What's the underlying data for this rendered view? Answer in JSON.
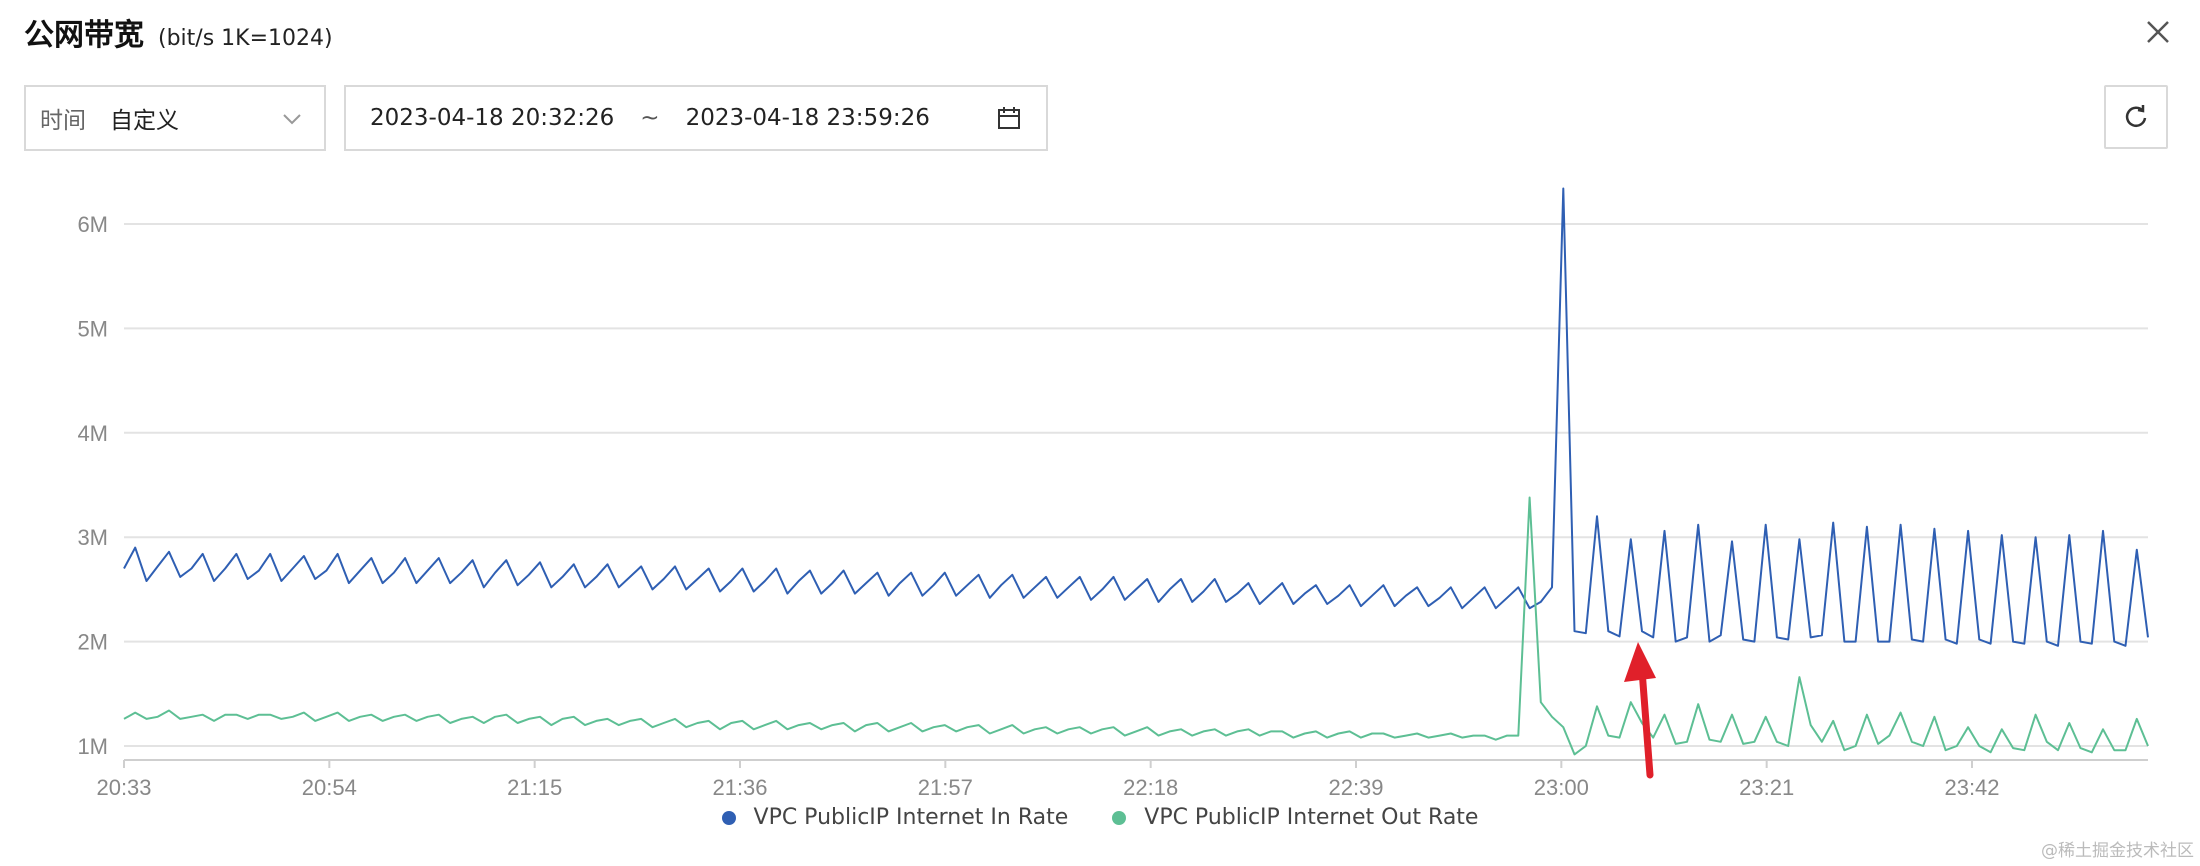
{
  "header": {
    "title": "公网带宽",
    "subtitle": "(bit/s  1K=1024)"
  },
  "time_filter": {
    "label": "时间",
    "value": "自定义"
  },
  "date_range": {
    "start": "2023-04-18 20:32:26",
    "separator": "~",
    "end": "2023-04-18 23:59:26"
  },
  "icons": {
    "close": "close-icon",
    "chevron": "chevron-down-icon",
    "calendar": "calendar-icon",
    "refresh": "refresh-icon"
  },
  "watermark": "@稀土掘金技术社区",
  "chart_data": {
    "type": "line",
    "x_start_minutes": 0,
    "x_end_minutes": 207,
    "x_ticks": [
      "20:33",
      "20:54",
      "21:15",
      "21:36",
      "21:57",
      "22:18",
      "22:39",
      "23:00",
      "23:21",
      "23:42"
    ],
    "y_ticks": [
      "1M",
      "2M",
      "3M",
      "4M",
      "5M",
      "6M"
    ],
    "ylim": [
      1,
      6
    ],
    "grid": true,
    "legend_position": "bottom",
    "series": [
      {
        "name": "VPC PublicIP Internet In Rate",
        "color": "#2f5fb3",
        "values": [
          2.7,
          2.9,
          2.58,
          2.72,
          2.86,
          2.62,
          2.7,
          2.84,
          2.58,
          2.7,
          2.84,
          2.6,
          2.68,
          2.84,
          2.58,
          2.7,
          2.82,
          2.6,
          2.68,
          2.84,
          2.56,
          2.68,
          2.8,
          2.56,
          2.66,
          2.8,
          2.56,
          2.68,
          2.8,
          2.56,
          2.66,
          2.78,
          2.52,
          2.66,
          2.78,
          2.54,
          2.64,
          2.76,
          2.52,
          2.62,
          2.74,
          2.52,
          2.62,
          2.74,
          2.52,
          2.62,
          2.72,
          2.5,
          2.6,
          2.72,
          2.5,
          2.6,
          2.7,
          2.48,
          2.58,
          2.7,
          2.48,
          2.58,
          2.7,
          2.46,
          2.58,
          2.68,
          2.46,
          2.56,
          2.68,
          2.46,
          2.56,
          2.66,
          2.44,
          2.56,
          2.66,
          2.44,
          2.54,
          2.66,
          2.44,
          2.54,
          2.64,
          2.42,
          2.54,
          2.64,
          2.42,
          2.52,
          2.62,
          2.42,
          2.52,
          2.62,
          2.4,
          2.5,
          2.62,
          2.4,
          2.5,
          2.6,
          2.38,
          2.5,
          2.6,
          2.38,
          2.48,
          2.6,
          2.38,
          2.46,
          2.56,
          2.36,
          2.46,
          2.56,
          2.36,
          2.46,
          2.54,
          2.36,
          2.44,
          2.54,
          2.34,
          2.44,
          2.54,
          2.34,
          2.44,
          2.52,
          2.34,
          2.42,
          2.52,
          2.32,
          2.42,
          2.52,
          2.32,
          2.42,
          2.52,
          2.32,
          2.38,
          2.52,
          6.34,
          2.1,
          2.08,
          3.2,
          2.1,
          2.05,
          2.98,
          2.1,
          2.04,
          3.06,
          2.0,
          2.04,
          3.12,
          2.0,
          2.06,
          2.96,
          2.02,
          2.0,
          3.12,
          2.04,
          2.02,
          2.98,
          2.04,
          2.06,
          3.14,
          2.0,
          2.0,
          3.1,
          2.0,
          2.0,
          3.12,
          2.02,
          2.0,
          3.08,
          2.02,
          1.98,
          3.06,
          2.02,
          1.98,
          3.02,
          2.0,
          1.98,
          3.0,
          2.0,
          1.96,
          3.02,
          2.0,
          1.98,
          3.06,
          2.0,
          1.96,
          2.88,
          2.04
        ]
      },
      {
        "name": "VPC PublicIP Internet Out Rate",
        "color": "#5dbf94",
        "values": [
          1.26,
          1.32,
          1.26,
          1.28,
          1.34,
          1.26,
          1.28,
          1.3,
          1.24,
          1.3,
          1.3,
          1.26,
          1.3,
          1.3,
          1.26,
          1.28,
          1.32,
          1.24,
          1.28,
          1.32,
          1.24,
          1.28,
          1.3,
          1.24,
          1.28,
          1.3,
          1.24,
          1.28,
          1.3,
          1.22,
          1.26,
          1.28,
          1.22,
          1.28,
          1.3,
          1.22,
          1.26,
          1.28,
          1.2,
          1.26,
          1.28,
          1.2,
          1.24,
          1.26,
          1.2,
          1.24,
          1.26,
          1.18,
          1.22,
          1.26,
          1.18,
          1.22,
          1.24,
          1.16,
          1.22,
          1.24,
          1.16,
          1.2,
          1.24,
          1.16,
          1.2,
          1.22,
          1.16,
          1.2,
          1.22,
          1.14,
          1.2,
          1.22,
          1.14,
          1.18,
          1.22,
          1.14,
          1.18,
          1.2,
          1.14,
          1.18,
          1.2,
          1.12,
          1.16,
          1.2,
          1.12,
          1.16,
          1.18,
          1.12,
          1.16,
          1.18,
          1.12,
          1.16,
          1.18,
          1.1,
          1.14,
          1.18,
          1.1,
          1.14,
          1.16,
          1.1,
          1.14,
          1.16,
          1.1,
          1.14,
          1.16,
          1.1,
          1.14,
          1.14,
          1.08,
          1.12,
          1.14,
          1.08,
          1.12,
          1.14,
          1.08,
          1.12,
          1.12,
          1.08,
          1.1,
          1.12,
          1.08,
          1.1,
          1.12,
          1.08,
          1.1,
          1.1,
          1.06,
          1.1,
          1.1,
          3.38,
          1.42,
          1.28,
          1.18,
          0.92,
          1.0,
          1.38,
          1.1,
          1.08,
          1.42,
          1.22,
          1.08,
          1.3,
          1.02,
          1.04,
          1.4,
          1.06,
          1.04,
          1.3,
          1.02,
          1.04,
          1.28,
          1.04,
          1.0,
          1.66,
          1.2,
          1.04,
          1.24,
          0.96,
          1.0,
          1.3,
          1.02,
          1.1,
          1.32,
          1.04,
          1.0,
          1.28,
          0.96,
          1.0,
          1.18,
          1.0,
          0.94,
          1.16,
          0.98,
          0.96,
          1.3,
          1.04,
          0.96,
          1.22,
          0.98,
          0.94,
          1.16,
          0.96,
          0.96,
          1.26,
          1.0
        ]
      }
    ]
  }
}
